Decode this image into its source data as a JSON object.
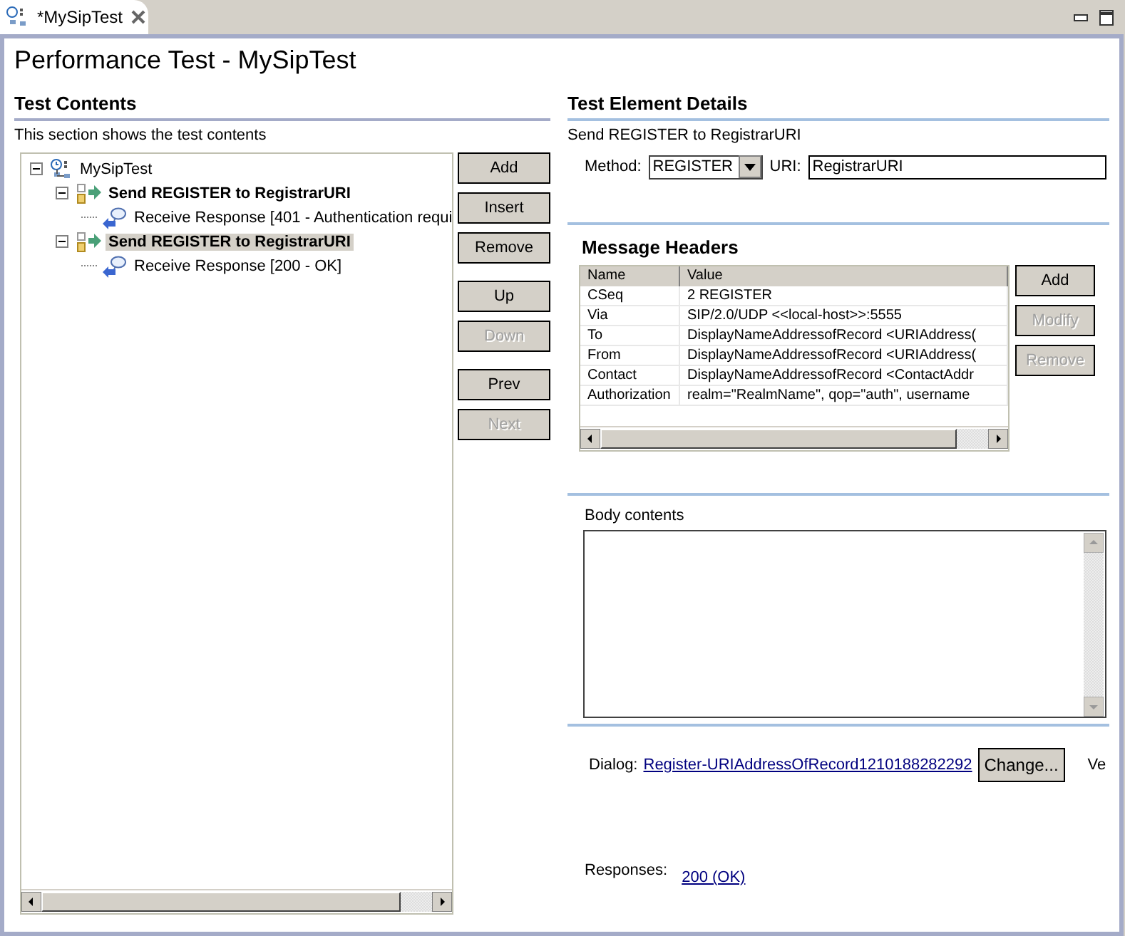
{
  "tab": {
    "title": "*MySipTest"
  },
  "page_title": "Performance Test - MySipTest",
  "test_contents": {
    "heading": "Test Contents",
    "description": "This section shows the test contents",
    "tree": [
      {
        "kind": "test",
        "label": "MySipTest",
        "expanded": true,
        "selected": false,
        "children": [
          {
            "kind": "send",
            "label": "Send REGISTER to RegistrarURI",
            "expanded": true,
            "selected": false,
            "children": [
              {
                "kind": "receive",
                "label": "Receive Response [401 - Authentication requi",
                "selected": false
              }
            ]
          },
          {
            "kind": "send",
            "label": "Send REGISTER to RegistrarURI",
            "expanded": true,
            "selected": true,
            "children": [
              {
                "kind": "receive",
                "label": "Receive Response [200 - OK]",
                "selected": false
              }
            ]
          }
        ]
      }
    ],
    "buttons": [
      {
        "label": "Add",
        "disabled": false
      },
      {
        "label": "Insert",
        "disabled": false
      },
      {
        "label": "Remove",
        "disabled": false
      },
      {
        "label": "Up",
        "disabled": false
      },
      {
        "label": "Down",
        "disabled": true
      },
      {
        "label": "Prev",
        "disabled": false
      },
      {
        "label": "Next",
        "disabled": true
      }
    ]
  },
  "details": {
    "heading": "Test Element Details",
    "element_name": "Send REGISTER to RegistrarURI",
    "method": {
      "label": "Method:",
      "value": "REGISTER"
    },
    "uri": {
      "label": "URI:",
      "value": "RegistrarURI"
    }
  },
  "message_headers": {
    "heading": "Message Headers",
    "columns": [
      "Name",
      "Value"
    ],
    "rows": [
      {
        "name": "CSeq",
        "value": "2 REGISTER"
      },
      {
        "name": "Via",
        "value": "SIP/2.0/UDP <<local-host>>:5555"
      },
      {
        "name": "To",
        "value": "DisplayNameAddressofRecord <URIAddress("
      },
      {
        "name": "From",
        "value": "DisplayNameAddressofRecord <URIAddress("
      },
      {
        "name": "Contact",
        "value": "DisplayNameAddressofRecord <ContactAddr"
      },
      {
        "name": "Authorization",
        "value": "realm=\"RealmName\", qop=\"auth\", username"
      }
    ],
    "buttons": [
      {
        "label": "Add",
        "disabled": false
      },
      {
        "label": "Modify",
        "disabled": true
      },
      {
        "label": "Remove",
        "disabled": true
      }
    ]
  },
  "body_contents": {
    "label": "Body contents"
  },
  "dialog": {
    "label": "Dialog:",
    "link": "Register-URIAddressOfRecord1210188282292",
    "button": "Change...",
    "cut_text": "Ve"
  },
  "responses": {
    "label": "Responses:",
    "link": "200 (OK)"
  }
}
